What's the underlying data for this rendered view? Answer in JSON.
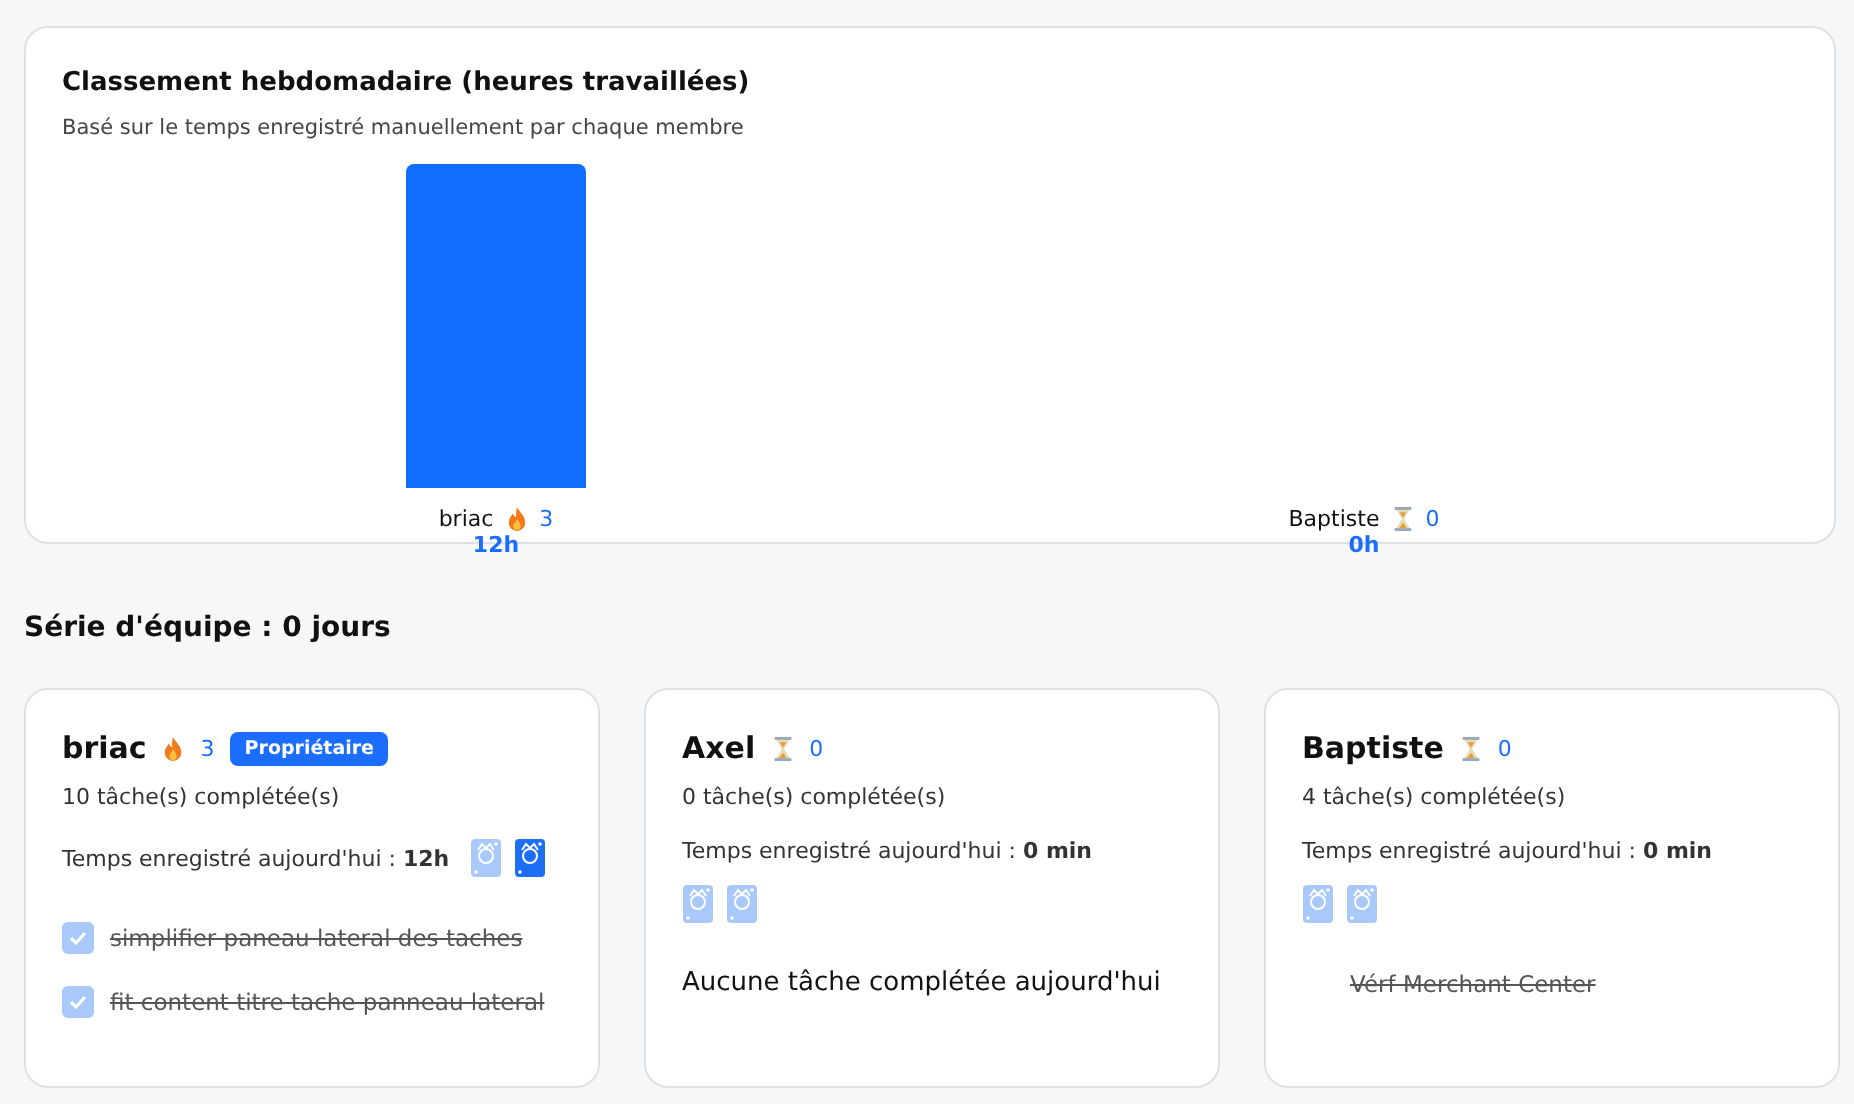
{
  "leaderboard": {
    "title": "Classement hebdomadaire (heures travaillées)",
    "subtitle": "Basé sur le temps enregistré manuellement par chaque membre",
    "chart_data": {
      "type": "bar",
      "categories": [
        "briac",
        "Baptiste"
      ],
      "values": [
        12,
        0
      ],
      "value_labels": [
        "12h",
        "0h"
      ]
    },
    "streaks": [
      {
        "kind": "fire",
        "count": "3"
      },
      {
        "kind": "hourglass",
        "count": "0"
      }
    ]
  },
  "team_streak": "Série d'équipe : 0 jours",
  "members": [
    {
      "name": "briac",
      "kind": "fire",
      "streak": "3",
      "badge": "Propriétaire",
      "completed": "10 tâche(s) complétée(s)",
      "time_label": "Temps enregistré aujourd'hui : ",
      "time_value": "12h",
      "jokers": [
        {
          "used": false
        },
        {
          "used": true
        }
      ],
      "tasks": [
        {
          "text": "simplifier paneau lateral des taches",
          "checked": true
        },
        {
          "text": "fit content titre tache panneau lateral",
          "checked": true
        }
      ]
    },
    {
      "name": "Axel",
      "kind": "hourglass",
      "streak": "0",
      "completed": "0 tâche(s) complétée(s)",
      "time_label": "Temps enregistré aujourd'hui : ",
      "time_value": "0 min",
      "jokers": [
        {
          "used": false
        },
        {
          "used": false
        }
      ],
      "empty_message": "Aucune tâche complétée aujourd'hui"
    },
    {
      "name": "Baptiste",
      "kind": "hourglass",
      "streak": "0",
      "completed": "4 tâche(s) complétée(s)",
      "time_label": "Temps enregistré aujourd'hui : ",
      "time_value": "0 min",
      "jokers": [
        {
          "used": false
        },
        {
          "used": false
        }
      ],
      "tasks": [
        {
          "text": "Vérf Merchant Center",
          "checked": false
        }
      ]
    }
  ]
}
